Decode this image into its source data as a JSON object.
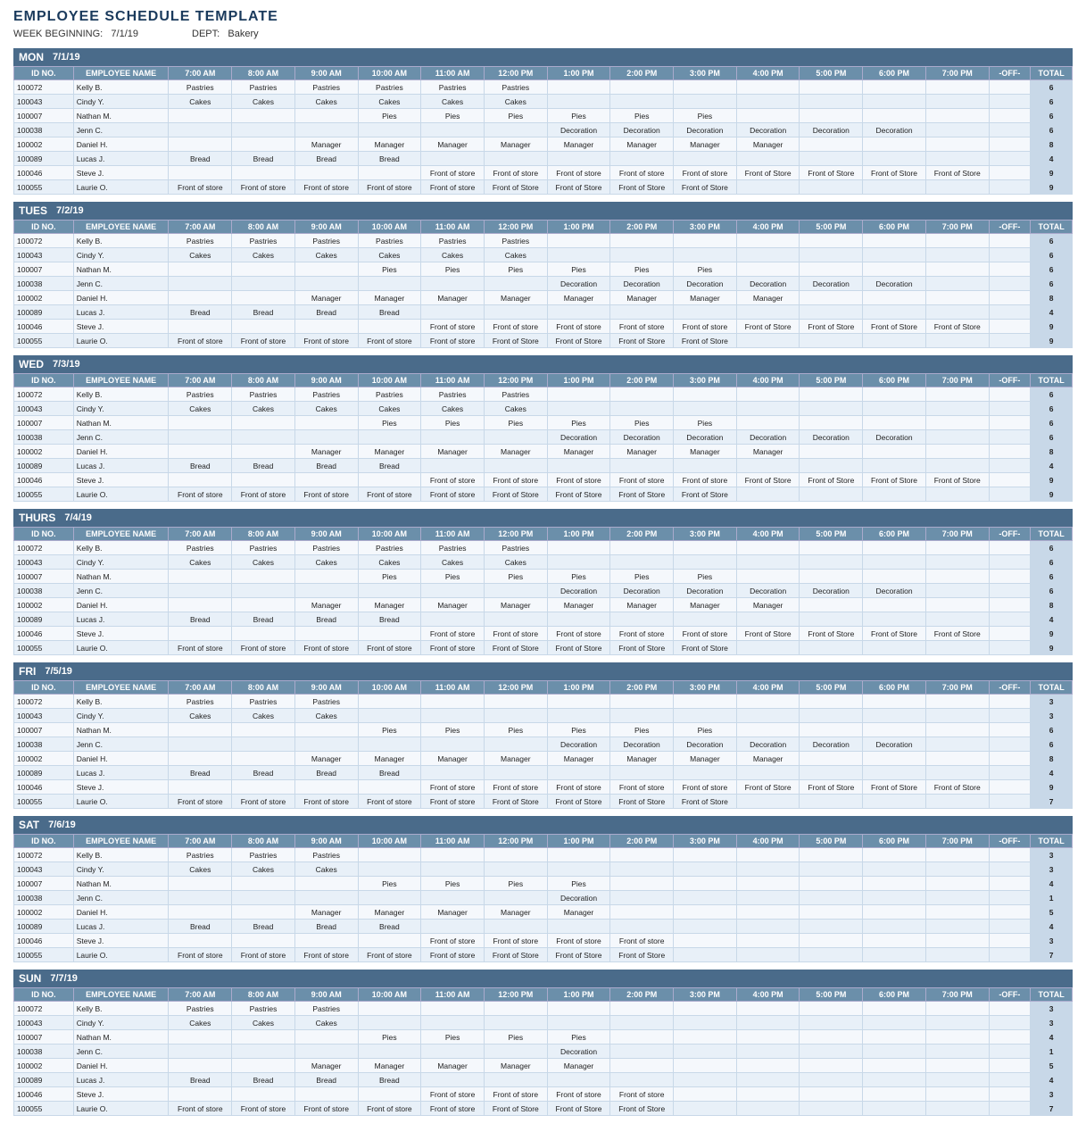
{
  "title": "EMPLOYEE SCHEDULE TEMPLATE",
  "meta": {
    "week_label": "WEEK BEGINNING:",
    "week_value": "7/1/19",
    "dept_label": "DEPT:",
    "dept_value": "Bakery"
  },
  "columns": [
    "ID NO.",
    "EMPLOYEE NAME",
    "7:00 AM",
    "8:00 AM",
    "9:00 AM",
    "10:00 AM",
    "11:00 AM",
    "12:00 PM",
    "1:00 PM",
    "2:00 PM",
    "3:00 PM",
    "4:00 PM",
    "5:00 PM",
    "6:00 PM",
    "7:00 PM",
    "-OFF-",
    "TOTAL"
  ],
  "days": [
    {
      "day": "MON",
      "date": "7/1/19",
      "rows": [
        [
          "100072",
          "Kelly B.",
          "Pastries",
          "Pastries",
          "Pastries",
          "Pastries",
          "Pastries",
          "Pastries",
          "",
          "",
          "",
          "",
          "",
          "",
          "",
          "",
          "6"
        ],
        [
          "100043",
          "Cindy Y.",
          "Cakes",
          "Cakes",
          "Cakes",
          "Cakes",
          "Cakes",
          "Cakes",
          "",
          "",
          "",
          "",
          "",
          "",
          "",
          "",
          "6"
        ],
        [
          "100007",
          "Nathan M.",
          "",
          "",
          "",
          "Pies",
          "Pies",
          "Pies",
          "Pies",
          "Pies",
          "Pies",
          "",
          "",
          "",
          "",
          "",
          "6"
        ],
        [
          "100038",
          "Jenn C.",
          "",
          "",
          "",
          "",
          "",
          "",
          "Decoration",
          "Decoration",
          "Decoration",
          "Decoration",
          "Decoration",
          "Decoration",
          "",
          "",
          "6"
        ],
        [
          "100002",
          "Daniel H.",
          "",
          "",
          "Manager",
          "Manager",
          "Manager",
          "Manager",
          "Manager",
          "Manager",
          "Manager",
          "Manager",
          "",
          "",
          "",
          "",
          "8"
        ],
        [
          "100089",
          "Lucas J.",
          "Bread",
          "Bread",
          "Bread",
          "Bread",
          "",
          "",
          "",
          "",
          "",
          "",
          "",
          "",
          "",
          "",
          "4"
        ],
        [
          "100046",
          "Steve J.",
          "",
          "",
          "",
          "",
          "Front of store",
          "Front of store",
          "Front of store",
          "Front of store",
          "Front of store",
          "Front of Store",
          "Front of Store",
          "Front of Store",
          "Front of Store",
          "",
          "9"
        ],
        [
          "100055",
          "Laurie O.",
          "Front of store",
          "Front of store",
          "Front of store",
          "Front of store",
          "Front of store",
          "Front of Store",
          "Front of Store",
          "Front of Store",
          "Front of Store",
          "",
          "",
          "",
          "",
          "",
          "9"
        ]
      ]
    },
    {
      "day": "TUES",
      "date": "7/2/19",
      "rows": [
        [
          "100072",
          "Kelly B.",
          "Pastries",
          "Pastries",
          "Pastries",
          "Pastries",
          "Pastries",
          "Pastries",
          "",
          "",
          "",
          "",
          "",
          "",
          "",
          "",
          "6"
        ],
        [
          "100043",
          "Cindy Y.",
          "Cakes",
          "Cakes",
          "Cakes",
          "Cakes",
          "Cakes",
          "Cakes",
          "",
          "",
          "",
          "",
          "",
          "",
          "",
          "",
          "6"
        ],
        [
          "100007",
          "Nathan M.",
          "",
          "",
          "",
          "Pies",
          "Pies",
          "Pies",
          "Pies",
          "Pies",
          "Pies",
          "",
          "",
          "",
          "",
          "",
          "6"
        ],
        [
          "100038",
          "Jenn C.",
          "",
          "",
          "",
          "",
          "",
          "",
          "Decoration",
          "Decoration",
          "Decoration",
          "Decoration",
          "Decoration",
          "Decoration",
          "",
          "",
          "6"
        ],
        [
          "100002",
          "Daniel H.",
          "",
          "",
          "Manager",
          "Manager",
          "Manager",
          "Manager",
          "Manager",
          "Manager",
          "Manager",
          "Manager",
          "",
          "",
          "",
          "",
          "8"
        ],
        [
          "100089",
          "Lucas J.",
          "Bread",
          "Bread",
          "Bread",
          "Bread",
          "",
          "",
          "",
          "",
          "",
          "",
          "",
          "",
          "",
          "",
          "4"
        ],
        [
          "100046",
          "Steve J.",
          "",
          "",
          "",
          "",
          "Front of store",
          "Front of store",
          "Front of store",
          "Front of store",
          "Front of store",
          "Front of Store",
          "Front of Store",
          "Front of Store",
          "Front of Store",
          "",
          "9"
        ],
        [
          "100055",
          "Laurie O.",
          "Front of store",
          "Front of store",
          "Front of store",
          "Front of store",
          "Front of store",
          "Front of Store",
          "Front of Store",
          "Front of Store",
          "Front of Store",
          "",
          "",
          "",
          "",
          "",
          "9"
        ]
      ]
    },
    {
      "day": "WED",
      "date": "7/3/19",
      "rows": [
        [
          "100072",
          "Kelly B.",
          "Pastries",
          "Pastries",
          "Pastries",
          "Pastries",
          "Pastries",
          "Pastries",
          "",
          "",
          "",
          "",
          "",
          "",
          "",
          "",
          "6"
        ],
        [
          "100043",
          "Cindy Y.",
          "Cakes",
          "Cakes",
          "Cakes",
          "Cakes",
          "Cakes",
          "Cakes",
          "",
          "",
          "",
          "",
          "",
          "",
          "",
          "",
          "6"
        ],
        [
          "100007",
          "Nathan M.",
          "",
          "",
          "",
          "Pies",
          "Pies",
          "Pies",
          "Pies",
          "Pies",
          "Pies",
          "",
          "",
          "",
          "",
          "",
          "6"
        ],
        [
          "100038",
          "Jenn C.",
          "",
          "",
          "",
          "",
          "",
          "",
          "Decoration",
          "Decoration",
          "Decoration",
          "Decoration",
          "Decoration",
          "Decoration",
          "",
          "",
          "6"
        ],
        [
          "100002",
          "Daniel H.",
          "",
          "",
          "Manager",
          "Manager",
          "Manager",
          "Manager",
          "Manager",
          "Manager",
          "Manager",
          "Manager",
          "",
          "",
          "",
          "",
          "8"
        ],
        [
          "100089",
          "Lucas J.",
          "Bread",
          "Bread",
          "Bread",
          "Bread",
          "",
          "",
          "",
          "",
          "",
          "",
          "",
          "",
          "",
          "",
          "4"
        ],
        [
          "100046",
          "Steve J.",
          "",
          "",
          "",
          "",
          "Front of store",
          "Front of store",
          "Front of store",
          "Front of store",
          "Front of store",
          "Front of Store",
          "Front of Store",
          "Front of Store",
          "Front of Store",
          "",
          "9"
        ],
        [
          "100055",
          "Laurie O.",
          "Front of store",
          "Front of store",
          "Front of store",
          "Front of store",
          "Front of store",
          "Front of Store",
          "Front of Store",
          "Front of Store",
          "Front of Store",
          "",
          "",
          "",
          "",
          "",
          "9"
        ]
      ]
    },
    {
      "day": "THURS",
      "date": "7/4/19",
      "rows": [
        [
          "100072",
          "Kelly B.",
          "Pastries",
          "Pastries",
          "Pastries",
          "Pastries",
          "Pastries",
          "Pastries",
          "",
          "",
          "",
          "",
          "",
          "",
          "",
          "",
          "6"
        ],
        [
          "100043",
          "Cindy Y.",
          "Cakes",
          "Cakes",
          "Cakes",
          "Cakes",
          "Cakes",
          "Cakes",
          "",
          "",
          "",
          "",
          "",
          "",
          "",
          "",
          "6"
        ],
        [
          "100007",
          "Nathan M.",
          "",
          "",
          "",
          "Pies",
          "Pies",
          "Pies",
          "Pies",
          "Pies",
          "Pies",
          "",
          "",
          "",
          "",
          "",
          "6"
        ],
        [
          "100038",
          "Jenn C.",
          "",
          "",
          "",
          "",
          "",
          "",
          "Decoration",
          "Decoration",
          "Decoration",
          "Decoration",
          "Decoration",
          "Decoration",
          "",
          "",
          "6"
        ],
        [
          "100002",
          "Daniel H.",
          "",
          "",
          "Manager",
          "Manager",
          "Manager",
          "Manager",
          "Manager",
          "Manager",
          "Manager",
          "Manager",
          "",
          "",
          "",
          "",
          "8"
        ],
        [
          "100089",
          "Lucas J.",
          "Bread",
          "Bread",
          "Bread",
          "Bread",
          "",
          "",
          "",
          "",
          "",
          "",
          "",
          "",
          "",
          "",
          "4"
        ],
        [
          "100046",
          "Steve J.",
          "",
          "",
          "",
          "",
          "Front of store",
          "Front of store",
          "Front of store",
          "Front of store",
          "Front of store",
          "Front of Store",
          "Front of Store",
          "Front of Store",
          "Front of Store",
          "",
          "9"
        ],
        [
          "100055",
          "Laurie O.",
          "Front of store",
          "Front of store",
          "Front of store",
          "Front of store",
          "Front of store",
          "Front of Store",
          "Front of Store",
          "Front of Store",
          "Front of Store",
          "",
          "",
          "",
          "",
          "",
          "9"
        ]
      ]
    },
    {
      "day": "FRI",
      "date": "7/5/19",
      "rows": [
        [
          "100072",
          "Kelly B.",
          "Pastries",
          "Pastries",
          "Pastries",
          "",
          "",
          "",
          "",
          "",
          "",
          "",
          "",
          "",
          "",
          "",
          "3"
        ],
        [
          "100043",
          "Cindy Y.",
          "Cakes",
          "Cakes",
          "Cakes",
          "",
          "",
          "",
          "",
          "",
          "",
          "",
          "",
          "",
          "",
          "",
          "3"
        ],
        [
          "100007",
          "Nathan M.",
          "",
          "",
          "",
          "Pies",
          "Pies",
          "Pies",
          "Pies",
          "Pies",
          "Pies",
          "",
          "",
          "",
          "",
          "",
          "6"
        ],
        [
          "100038",
          "Jenn C.",
          "",
          "",
          "",
          "",
          "",
          "",
          "Decoration",
          "Decoration",
          "Decoration",
          "Decoration",
          "Decoration",
          "Decoration",
          "",
          "",
          "6"
        ],
        [
          "100002",
          "Daniel H.",
          "",
          "",
          "Manager",
          "Manager",
          "Manager",
          "Manager",
          "Manager",
          "Manager",
          "Manager",
          "Manager",
          "",
          "",
          "",
          "",
          "8"
        ],
        [
          "100089",
          "Lucas J.",
          "Bread",
          "Bread",
          "Bread",
          "Bread",
          "",
          "",
          "",
          "",
          "",
          "",
          "",
          "",
          "",
          "",
          "4"
        ],
        [
          "100046",
          "Steve J.",
          "",
          "",
          "",
          "",
          "Front of store",
          "Front of store",
          "Front of store",
          "Front of store",
          "Front of store",
          "Front of Store",
          "Front of Store",
          "Front of Store",
          "Front of Store",
          "",
          "9"
        ],
        [
          "100055",
          "Laurie O.",
          "Front of store",
          "Front of store",
          "Front of store",
          "Front of store",
          "Front of store",
          "Front of Store",
          "Front of Store",
          "Front of Store",
          "Front of Store",
          "",
          "",
          "",
          "",
          "",
          "7"
        ]
      ]
    },
    {
      "day": "SAT",
      "date": "7/6/19",
      "rows": [
        [
          "100072",
          "Kelly B.",
          "Pastries",
          "Pastries",
          "Pastries",
          "",
          "",
          "",
          "",
          "",
          "",
          "",
          "",
          "",
          "",
          "",
          "3"
        ],
        [
          "100043",
          "Cindy Y.",
          "Cakes",
          "Cakes",
          "Cakes",
          "",
          "",
          "",
          "",
          "",
          "",
          "",
          "",
          "",
          "",
          "",
          "3"
        ],
        [
          "100007",
          "Nathan M.",
          "",
          "",
          "",
          "Pies",
          "Pies",
          "Pies",
          "Pies",
          "",
          "",
          "",
          "",
          "",
          "",
          "",
          "4"
        ],
        [
          "100038",
          "Jenn C.",
          "",
          "",
          "",
          "",
          "",
          "",
          "Decoration",
          "",
          "",
          "",
          "",
          "",
          "",
          "",
          "1"
        ],
        [
          "100002",
          "Daniel H.",
          "",
          "",
          "Manager",
          "Manager",
          "Manager",
          "Manager",
          "Manager",
          "",
          "",
          "",
          "",
          "",
          "",
          "",
          "5"
        ],
        [
          "100089",
          "Lucas J.",
          "Bread",
          "Bread",
          "Bread",
          "Bread",
          "",
          "",
          "",
          "",
          "",
          "",
          "",
          "",
          "",
          "",
          "4"
        ],
        [
          "100046",
          "Steve J.",
          "",
          "",
          "",
          "",
          "Front of store",
          "Front of store",
          "Front of store",
          "Front of store",
          "",
          "",
          "",
          "",
          "",
          "",
          "3"
        ],
        [
          "100055",
          "Laurie O.",
          "Front of store",
          "Front of store",
          "Front of store",
          "Front of store",
          "Front of store",
          "Front of Store",
          "Front of Store",
          "Front of Store",
          "",
          "",
          "",
          "",
          "",
          "",
          "7"
        ]
      ]
    },
    {
      "day": "SUN",
      "date": "7/7/19",
      "rows": [
        [
          "100072",
          "Kelly B.",
          "Pastries",
          "Pastries",
          "Pastries",
          "",
          "",
          "",
          "",
          "",
          "",
          "",
          "",
          "",
          "",
          "",
          "3"
        ],
        [
          "100043",
          "Cindy Y.",
          "Cakes",
          "Cakes",
          "Cakes",
          "",
          "",
          "",
          "",
          "",
          "",
          "",
          "",
          "",
          "",
          "",
          "3"
        ],
        [
          "100007",
          "Nathan M.",
          "",
          "",
          "",
          "Pies",
          "Pies",
          "Pies",
          "Pies",
          "",
          "",
          "",
          "",
          "",
          "",
          "",
          "4"
        ],
        [
          "100038",
          "Jenn C.",
          "",
          "",
          "",
          "",
          "",
          "",
          "Decoration",
          "",
          "",
          "",
          "",
          "",
          "",
          "",
          "1"
        ],
        [
          "100002",
          "Daniel H.",
          "",
          "",
          "Manager",
          "Manager",
          "Manager",
          "Manager",
          "Manager",
          "",
          "",
          "",
          "",
          "",
          "",
          "",
          "5"
        ],
        [
          "100089",
          "Lucas J.",
          "Bread",
          "Bread",
          "Bread",
          "Bread",
          "",
          "",
          "",
          "",
          "",
          "",
          "",
          "",
          "",
          "",
          "4"
        ],
        [
          "100046",
          "Steve J.",
          "",
          "",
          "",
          "",
          "Front of store",
          "Front of store",
          "Front of store",
          "Front of store",
          "",
          "",
          "",
          "",
          "",
          "",
          "3"
        ],
        [
          "100055",
          "Laurie O.",
          "Front of store",
          "Front of store",
          "Front of store",
          "Front of store",
          "Front of store",
          "Front of Store",
          "Front of Store",
          "Front of Store",
          "",
          "",
          "",
          "",
          "",
          "",
          "7"
        ]
      ]
    }
  ]
}
